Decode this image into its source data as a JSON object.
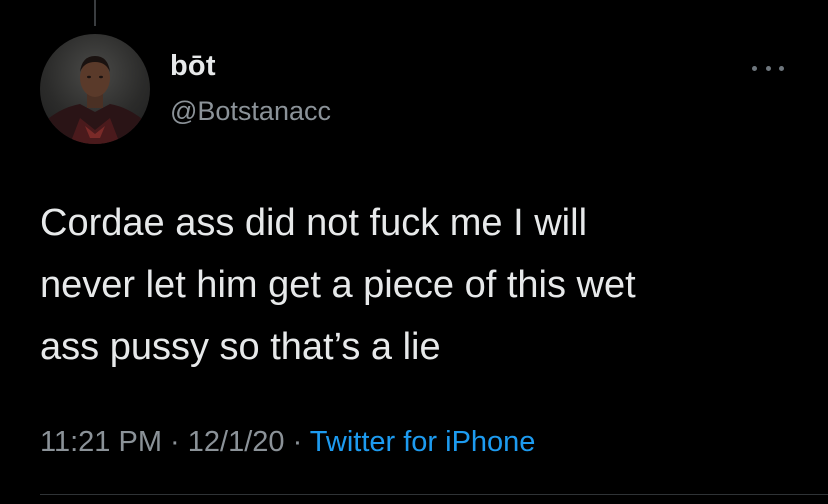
{
  "tweet": {
    "display_name": "bōt",
    "handle": "@Botstanacc",
    "text": "Cordae ass did not fuck me I will\nnever let him get a piece of this wet\nass pussy so that’s a lie",
    "time": "11:21 PM",
    "separator_1": " · ",
    "date": "12/1/20",
    "separator_2": " · ",
    "source": "Twitter for iPhone"
  },
  "icons": {
    "more": "more-horizontal-icon",
    "avatar": "profile-avatar"
  },
  "colors": {
    "background": "#000000",
    "primary_text": "#e7e9ea",
    "secondary_text": "#8b9298",
    "link": "#1d9bf0",
    "divider": "#2f3336"
  }
}
